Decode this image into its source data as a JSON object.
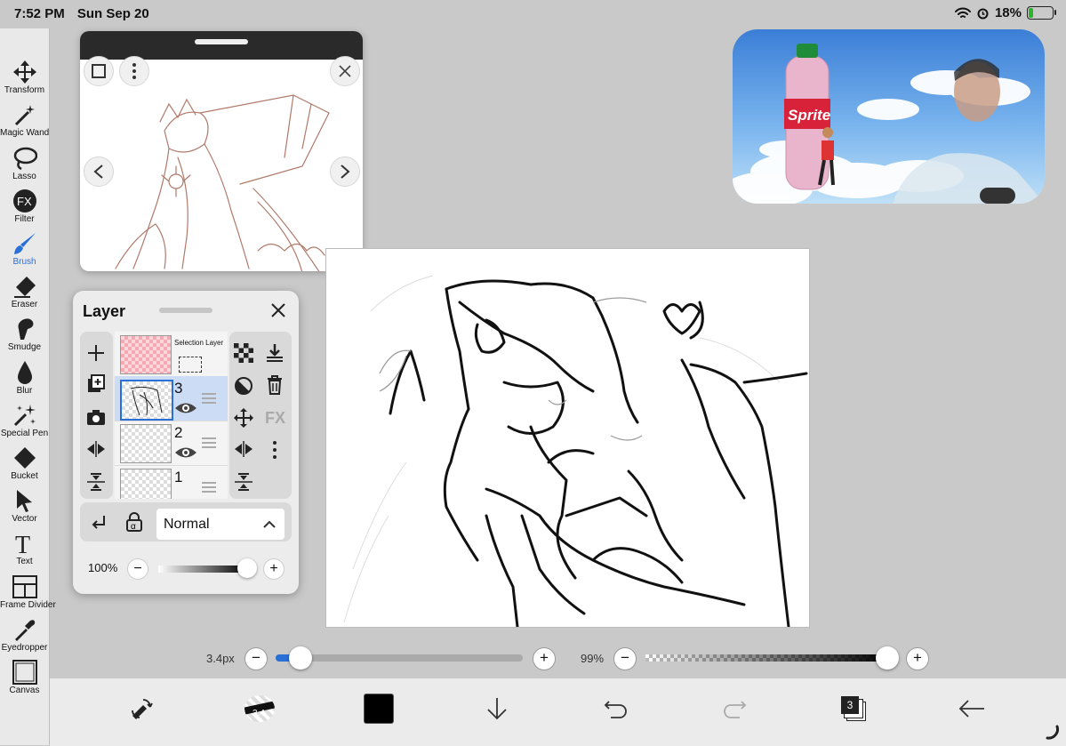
{
  "status": {
    "time": "7:52 PM",
    "date": "Sun Sep 20",
    "battery": "18%",
    "battery_level": 0.18
  },
  "toolbar": {
    "items": [
      {
        "label": "Transform",
        "icon": "transform-icon"
      },
      {
        "label": "Magic Wand",
        "icon": "magic-wand-icon"
      },
      {
        "label": "Lasso",
        "icon": "lasso-icon"
      },
      {
        "label": "Filter",
        "icon": "fx-icon"
      },
      {
        "label": "Brush",
        "icon": "brush-icon"
      },
      {
        "label": "Eraser",
        "icon": "eraser-icon"
      },
      {
        "label": "Smudge",
        "icon": "smudge-icon"
      },
      {
        "label": "Blur",
        "icon": "droplet-icon"
      },
      {
        "label": "Special Pen",
        "icon": "sparkle-pen-icon"
      },
      {
        "label": "Bucket",
        "icon": "bucket-icon"
      },
      {
        "label": "Vector",
        "icon": "cursor-icon"
      },
      {
        "label": "Text",
        "icon": "text-icon"
      },
      {
        "label": "Frame Divider",
        "icon": "frame-divider-icon"
      },
      {
        "label": "Eyedropper",
        "icon": "eyedropper-icon"
      },
      {
        "label": "Canvas",
        "icon": "canvas-icon"
      }
    ],
    "active": "Brush"
  },
  "pip": {
    "bottle_label": "Sprite"
  },
  "layer_panel": {
    "title": "Layer",
    "selection_layer": "Selection Layer",
    "layers": [
      {
        "number": "3",
        "selected": true
      },
      {
        "number": "2",
        "selected": false
      },
      {
        "number": "1",
        "selected": false
      }
    ],
    "right_tools": {
      "fx": "FX"
    },
    "blend_mode": "Normal",
    "opacity": "100%",
    "opacity_level": 1.0
  },
  "brush_size": {
    "value": "3.4px",
    "level": 0.1
  },
  "brush_opacity": {
    "value": "99%",
    "level": 0.99
  },
  "bottom_bar": {
    "brush_size_label": "3.4",
    "layer_count": "3"
  },
  "colors": {
    "active_blue": "#2a6fd6",
    "current_color": "#000000"
  }
}
